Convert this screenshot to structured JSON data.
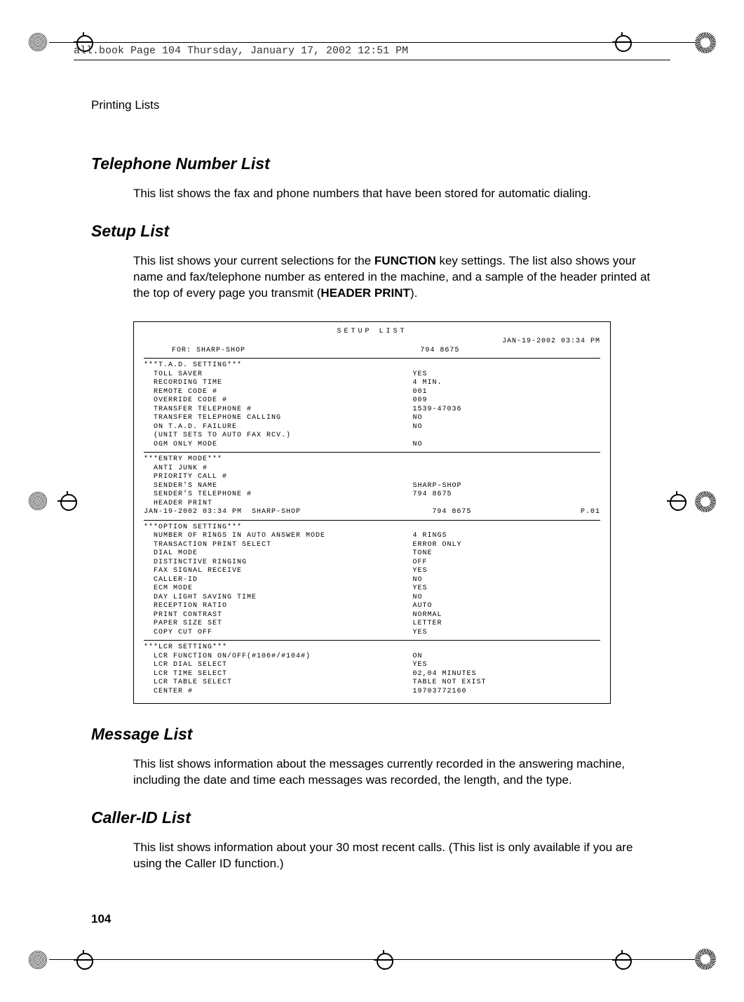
{
  "header": "all.book  Page 104  Thursday, January 17, 2002  12:51 PM",
  "breadcrumb": "Printing Lists",
  "sections": {
    "tel_heading": "Telephone Number List",
    "tel_body": "This list shows the fax and phone numbers that have been stored for automatic dialing.",
    "setup_heading": "Setup List",
    "setup_body_1": "This list shows your current selections for the ",
    "setup_body_bold1": "FUNCTION",
    "setup_body_2": " key settings. The list also shows your name and fax/telephone number as entered in the machine, and a sample of the header printed at the top of every page you transmit (",
    "setup_body_bold2": "HEADER PRINT",
    "setup_body_3": ").",
    "msg_heading": "Message List",
    "msg_body": "This list shows information about the messages currently recorded in the answering machine, including the date and time each messages was recorded, the length, and the type.",
    "cid_heading": "Caller-ID List",
    "cid_body": "This list shows information about your 30 most recent calls. (This list is only available if you are using the Caller ID function.)"
  },
  "setup": {
    "title": "SETUP LIST",
    "date": "JAN-19-2002 03:34 PM",
    "for_label": "FOR: SHARP-SHOP",
    "for_number": "794 8675",
    "groups": {
      "tad": {
        "title": "***T.A.D. SETTING***",
        "rows": [
          {
            "l": "TOLL SAVER",
            "r": "YES"
          },
          {
            "l": "RECORDING TIME",
            "r": "4 MIN."
          },
          {
            "l": "REMOTE CODE #",
            "r": "001"
          },
          {
            "l": "OVERRIDE CODE #",
            "r": "009"
          },
          {
            "l": "TRANSFER TELEPHONE #",
            "r": "1539-47036"
          },
          {
            "l": "TRANSFER TELEPHONE CALLING",
            "r": "NO"
          },
          {
            "l": "ON T.A.D. FAILURE",
            "r": "NO"
          },
          {
            "l": "(UNIT SETS TO AUTO FAX RCV.)",
            "r": ""
          },
          {
            "l": "OGM ONLY MODE",
            "r": "NO"
          }
        ]
      },
      "entry": {
        "title": "***ENTRY MODE***",
        "rows": [
          {
            "l": "ANTI JUNK #",
            "r": ""
          },
          {
            "l": "PRIORITY CALL #",
            "r": ""
          },
          {
            "l": "SENDER'S NAME",
            "r": "SHARP-SHOP"
          },
          {
            "l": "SENDER'S TELEPHONE #",
            "r": "794 8675"
          },
          {
            "l": "HEADER PRINT",
            "r": ""
          }
        ],
        "footer_l": "JAN-19-2002 03:34 PM  SHARP-SHOP",
        "footer_m": "794 8675",
        "footer_r": "P.01"
      },
      "option": {
        "title": "***OPTION SETTING***",
        "rows": [
          {
            "l": "NUMBER OF RINGS IN AUTO ANSWER MODE",
            "r": "4 RINGS"
          },
          {
            "l": "TRANSACTION PRINT SELECT",
            "r": "ERROR ONLY"
          },
          {
            "l": "DIAL MODE",
            "r": "TONE"
          },
          {
            "l": "DISTINCTIVE RINGING",
            "r": "OFF"
          },
          {
            "l": "FAX SIGNAL RECEIVE",
            "r": "YES"
          },
          {
            "l": "CALLER-ID",
            "r": "NO"
          },
          {
            "l": "ECM MODE",
            "r": "YES"
          },
          {
            "l": "DAY LIGHT SAVING TIME",
            "r": "NO"
          },
          {
            "l": "RECEPTION RATIO",
            "r": "AUTO"
          },
          {
            "l": "PRINT CONTRAST",
            "r": "NORMAL"
          },
          {
            "l": "PAPER SIZE SET",
            "r": "LETTER"
          },
          {
            "l": "COPY CUT OFF",
            "r": "YES"
          }
        ]
      },
      "lcr": {
        "title": "***LCR SETTING***",
        "rows": [
          {
            "l": "LCR FUNCTION ON/OFF(#106#/#104#)",
            "r": "ON"
          },
          {
            "l": "LCR DIAL SELECT",
            "r": "YES"
          },
          {
            "l": "LCR TIME SELECT",
            "r": "02,04 MINUTES"
          },
          {
            "l": "LCR TABLE SELECT",
            "r": "TABLE NOT EXIST"
          },
          {
            "l": "CENTER #",
            "r": "19703772160"
          }
        ]
      }
    }
  },
  "page_number": "104"
}
